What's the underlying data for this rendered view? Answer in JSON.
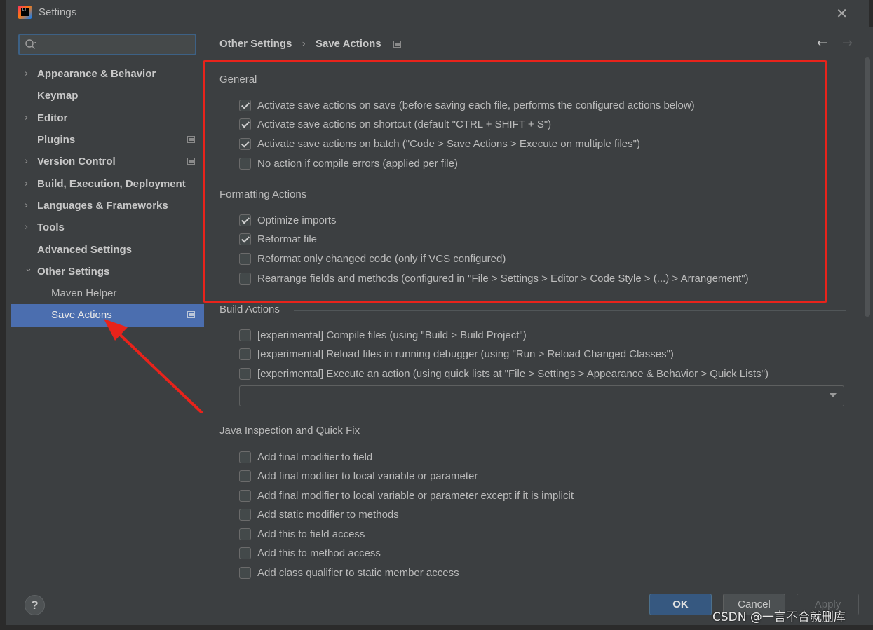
{
  "window": {
    "title": "Settings",
    "close_glyph": "✕",
    "icon": "intellij-app-icon",
    "icon_text": "IJ"
  },
  "search": {
    "placeholder": "",
    "icon": "search-icon"
  },
  "sidebar": {
    "items": [
      {
        "label": "Appearance & Behavior",
        "expandable": true,
        "expanded": false,
        "marker": false
      },
      {
        "label": "Keymap",
        "expandable": false,
        "marker": false
      },
      {
        "label": "Editor",
        "expandable": true,
        "expanded": false,
        "marker": false
      },
      {
        "label": "Plugins",
        "expandable": false,
        "marker": true
      },
      {
        "label": "Version Control",
        "expandable": true,
        "expanded": false,
        "marker": true
      },
      {
        "label": "Build, Execution, Deployment",
        "expandable": true,
        "expanded": false,
        "marker": false
      },
      {
        "label": "Languages & Frameworks",
        "expandable": true,
        "expanded": false,
        "marker": false
      },
      {
        "label": "Tools",
        "expandable": true,
        "expanded": false,
        "marker": false
      },
      {
        "label": "Advanced Settings",
        "expandable": false,
        "marker": false
      },
      {
        "label": "Other Settings",
        "expandable": true,
        "expanded": true,
        "marker": false
      },
      {
        "label": "Maven Helper",
        "child": true,
        "marker": false
      },
      {
        "label": "Save Actions",
        "child": true,
        "selected": true,
        "marker": true
      }
    ]
  },
  "breadcrumb": {
    "parent": "Other Settings",
    "separator": "›",
    "current": "Save Actions"
  },
  "nav": {
    "back": "←",
    "forward": "→"
  },
  "sections": {
    "general": {
      "title": "General",
      "options": [
        {
          "label": "Activate save actions on save (before saving each file, performs the configured actions below)",
          "checked": true
        },
        {
          "label": "Activate save actions on shortcut (default \"CTRL + SHIFT + S\")",
          "checked": true
        },
        {
          "label": "Activate save actions on batch (\"Code > Save Actions > Execute on multiple files\")",
          "checked": true
        },
        {
          "label": "No action if compile errors (applied per file)",
          "checked": false
        }
      ]
    },
    "formatting": {
      "title": "Formatting Actions",
      "options": [
        {
          "label": "Optimize imports",
          "checked": true
        },
        {
          "label": "Reformat file",
          "checked": true
        },
        {
          "label": "Reformat only changed code (only if VCS configured)",
          "checked": false
        },
        {
          "label": "Rearrange fields and methods (configured in \"File > Settings > Editor > Code Style > (...) > Arrangement\")",
          "checked": false
        }
      ]
    },
    "build": {
      "title": "Build Actions",
      "options": [
        {
          "label": "[experimental] Compile files (using \"Build > Build Project\")",
          "checked": false
        },
        {
          "label": "[experimental] Reload files in running debugger (using \"Run > Reload Changed Classes\")",
          "checked": false
        },
        {
          "label": "[experimental] Execute an action (using quick lists at \"File > Settings > Appearance & Behavior > Quick Lists\")",
          "checked": false
        }
      ],
      "dropdown_value": ""
    },
    "java": {
      "title": "Java Inspection and Quick Fix",
      "options": [
        {
          "label": "Add final modifier to field",
          "checked": false
        },
        {
          "label": "Add final modifier to local variable or parameter",
          "checked": false
        },
        {
          "label": "Add final modifier to local variable or parameter except if it is implicit",
          "checked": false
        },
        {
          "label": "Add static modifier to methods",
          "checked": false
        },
        {
          "label": "Add this to field access",
          "checked": false
        },
        {
          "label": "Add this to method access",
          "checked": false
        },
        {
          "label": "Add class qualifier to static member access",
          "checked": false
        }
      ]
    }
  },
  "footer": {
    "help": "?",
    "ok": "OK",
    "cancel": "Cancel",
    "apply": "Apply"
  },
  "watermark": "CSDN @一言不合就删库",
  "colors": {
    "background": "#3c3f41",
    "selection": "#4b6eaf",
    "annotation_red": "#e8231b",
    "ok_button": "#365880"
  }
}
